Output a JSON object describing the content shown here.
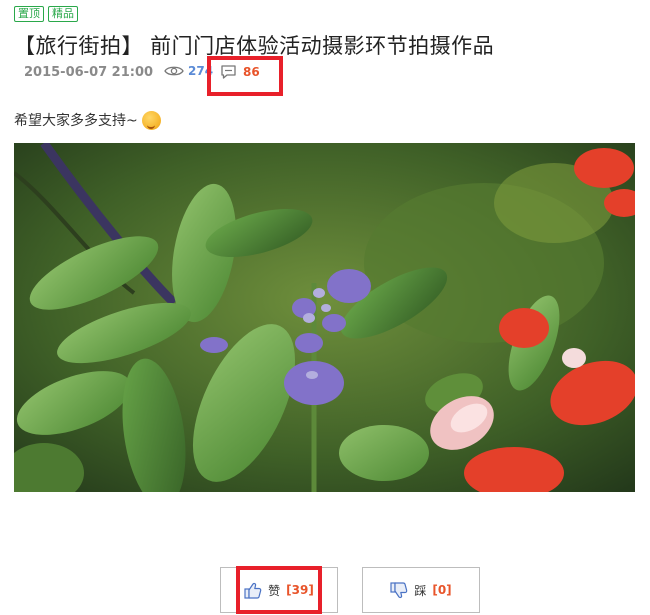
{
  "tags": [
    "置顶",
    "精品"
  ],
  "post": {
    "title": "【旅行街拍】 前门门店体验活动摄影环节拍摄作品",
    "date": "2015-06-07 21:00",
    "views": "274",
    "comments": "86",
    "intro": "希望大家多多支持~"
  },
  "actions": {
    "like_label": "赞",
    "like_count": "[39]",
    "dislike_label": "踩",
    "dislike_count": "[0]"
  },
  "icons": {
    "views": "eye-icon",
    "comments": "comment-icon",
    "like": "thumbs-up-icon",
    "dislike": "thumbs-down-icon",
    "emoji": "smile-emoji-icon"
  },
  "colors": {
    "tag": "#2aa84a",
    "highlight": "#e8202a",
    "count": "#e8542a",
    "views": "#5b8bd6"
  }
}
